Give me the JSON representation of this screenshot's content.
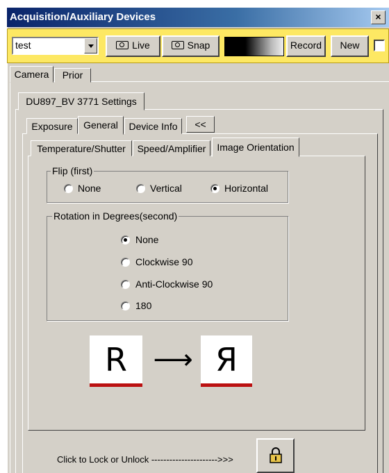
{
  "window": {
    "title": "Acquisition/Auxiliary Devices",
    "close_glyph": "×"
  },
  "toolbar": {
    "combo_value": "test",
    "live_label": "Live",
    "snap_label": "Snap",
    "record_label": "Record",
    "new_label": "New",
    "checkbox_checked": false
  },
  "main_tabs": {
    "camera": "Camera",
    "prior": "Prior"
  },
  "settings_tab": {
    "label": "DU897_BV 3771 Settings"
  },
  "sub_tabs": {
    "exposure": "Exposure",
    "general": "General",
    "device_info": "Device Info",
    "collapse": "<<"
  },
  "inner_tabs": {
    "temperature": "Temperature/Shutter",
    "speed": "Speed/Amplifier",
    "orientation": "Image Orientation"
  },
  "flip": {
    "legend": "Flip (first)",
    "none": "None",
    "vertical": "Vertical",
    "horizontal": "Horizontal",
    "selected": "Horizontal"
  },
  "rotation": {
    "legend": "Rotation in Degrees(second)",
    "none": "None",
    "cw90": "Clockwise 90",
    "acw90": "Anti-Clockwise 90",
    "r180": "180",
    "selected": "None"
  },
  "preview": {
    "before": "R",
    "arrow": "⟶",
    "after": "Я",
    "accent_color": "#b11111"
  },
  "lock": {
    "label": "Click to Lock or Unlock ---------------------->>>",
    "icon": "padlock-icon"
  }
}
